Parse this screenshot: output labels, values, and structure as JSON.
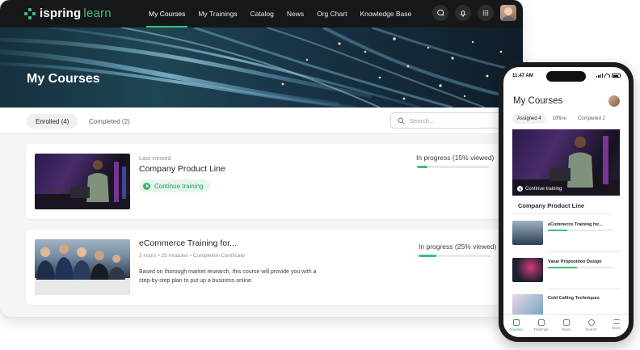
{
  "app": {
    "brand_main": "ispring",
    "brand_sub": "learn",
    "colors": {
      "accent": "#3cc07a",
      "topbar": "#151718"
    }
  },
  "nav": {
    "items": [
      {
        "label": "My Courses",
        "active": true
      },
      {
        "label": "My Trainings",
        "active": false
      },
      {
        "label": "Catalog",
        "active": false
      },
      {
        "label": "News",
        "active": false
      },
      {
        "label": "Org Chart",
        "active": false
      },
      {
        "label": "Knowledge Base",
        "active": false
      }
    ],
    "icons": [
      "chat-icon",
      "bell-icon",
      "apps-grid-icon"
    ]
  },
  "hero": {
    "title": "My Courses"
  },
  "tabs": {
    "enrolled": "Enrolled (4)",
    "completed": "Completed (2)"
  },
  "search": {
    "placeholder": "Search..."
  },
  "courses": [
    {
      "kicker": "Last viewed",
      "title": "Company Product Line",
      "continue_label": "Continue training",
      "progress_text": "In progress (15% viewed)",
      "progress": 0.15
    },
    {
      "title": "eCommerce Training for...",
      "meta": "3 hours  •  25 modules  •  Completion Certificate",
      "description": "Based on thorough market research, this course will provide you with a step-by-step plan to put up a business online.",
      "progress_text": "In progress (25% viewed)",
      "progress": 0.25
    }
  ],
  "phone": {
    "time": "11:47 AM",
    "title": "My Courses",
    "tabs": [
      "Assigned 4",
      "Offline",
      "Completed 2"
    ],
    "hero_continue": "Continue training",
    "hero_title": "Company Product Line",
    "list": [
      {
        "label": "eCommerce Training for...",
        "progress": 0.3
      },
      {
        "label": "Value Proposition Design",
        "progress": 0.45
      },
      {
        "label": "Cold Calling Techniques",
        "progress": 0
      }
    ],
    "bottom_nav": [
      "Courses",
      "Trainings",
      "News",
      "Search",
      "More"
    ]
  }
}
